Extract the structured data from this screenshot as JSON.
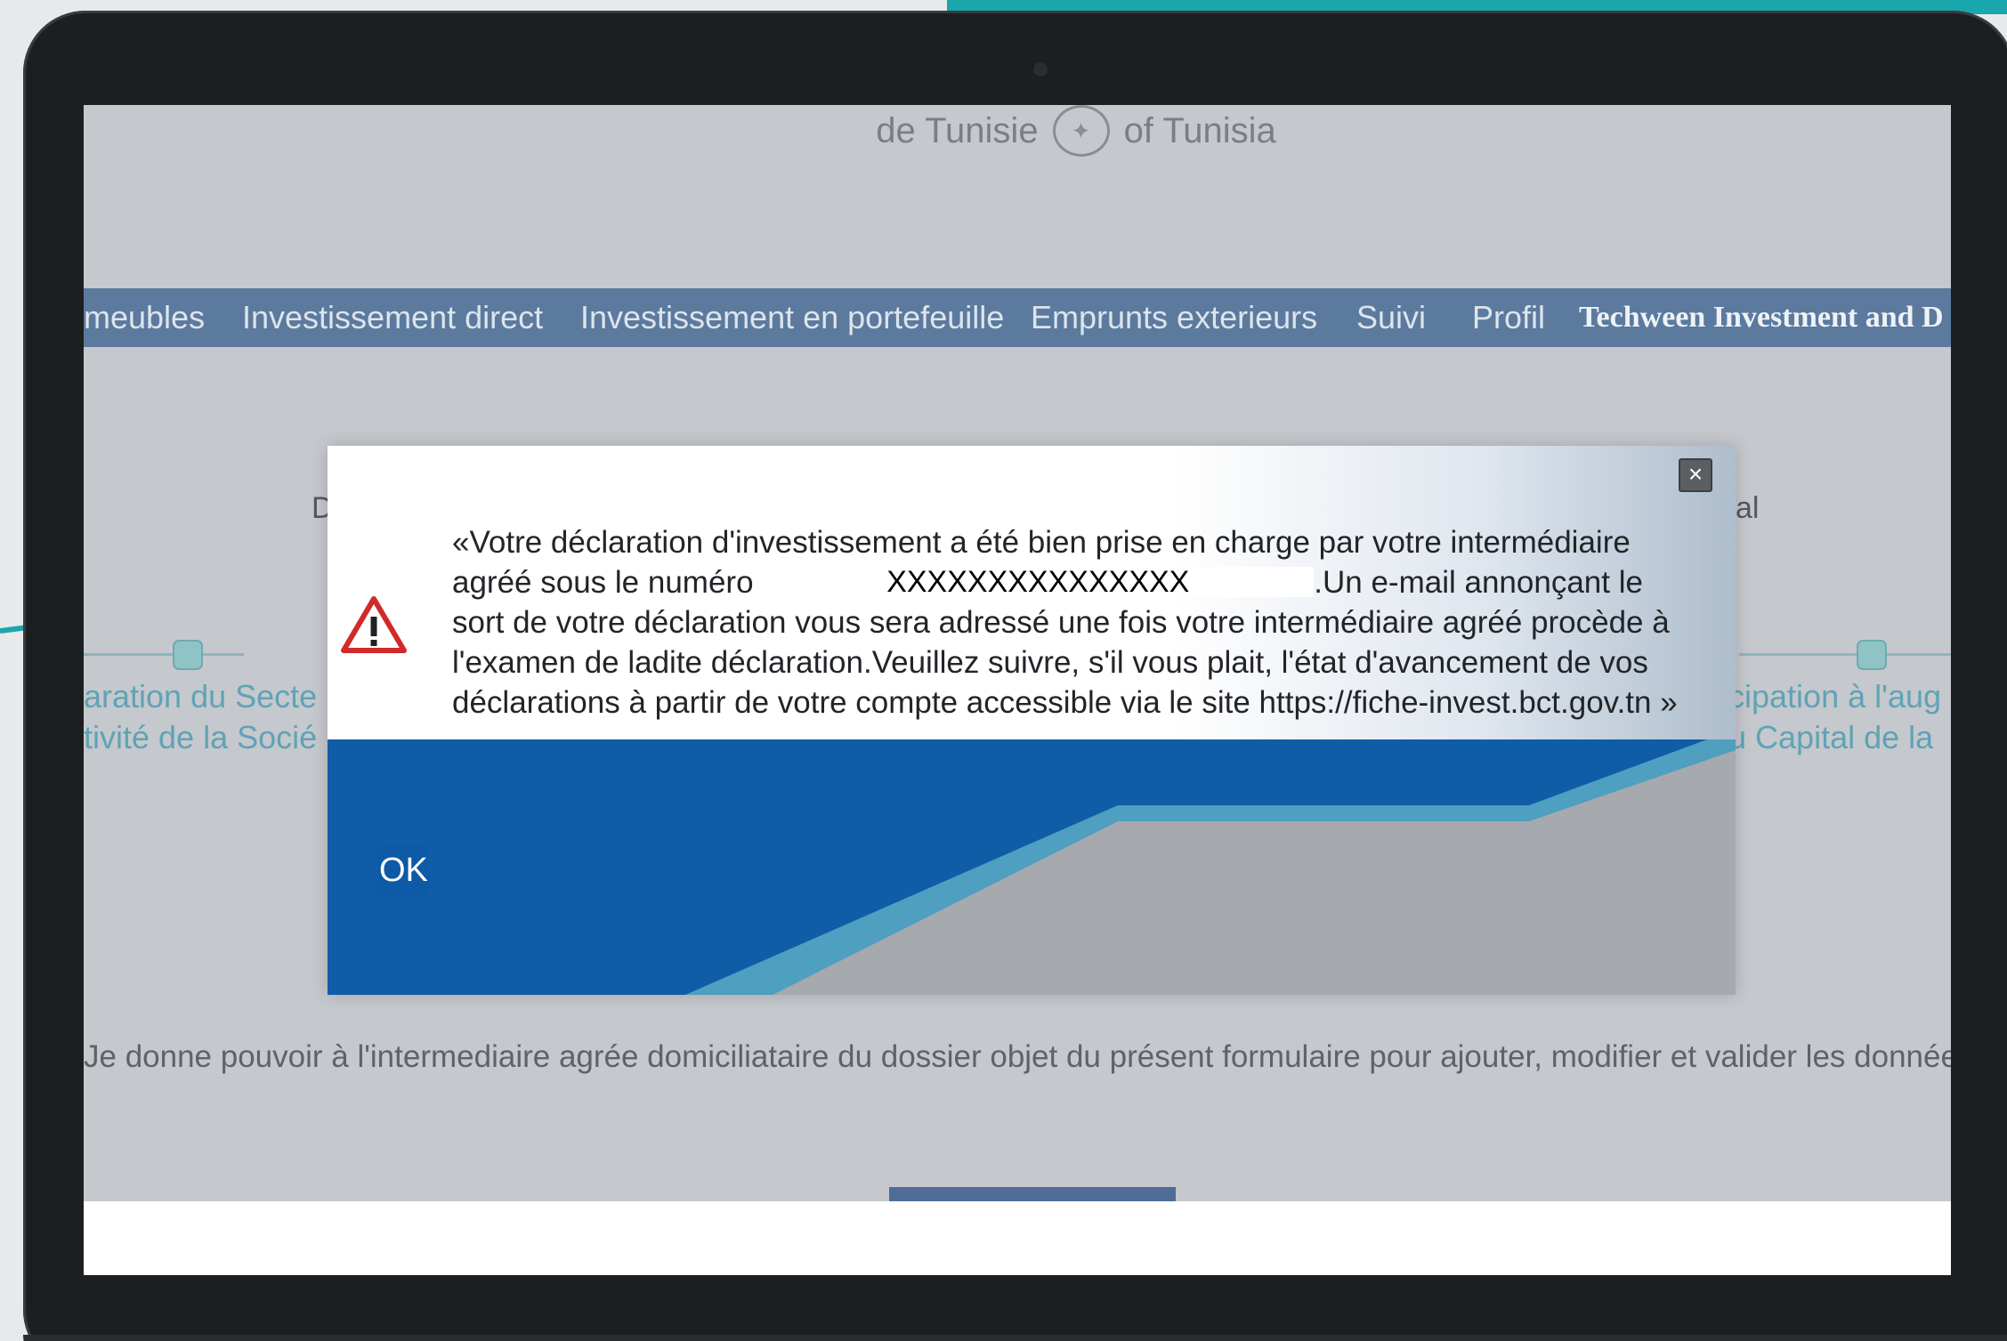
{
  "header": {
    "left_text": "de Tunisie",
    "right_text": "of Tunisia",
    "crest_icon": "crest-icon"
  },
  "nav": {
    "items": [
      "meubles",
      "Investissement direct",
      "Investissement en portefeuille",
      "Emprunts exterieurs",
      "Suivi",
      "Profil"
    ],
    "company": "Techween Investment and D"
  },
  "background_fragments": {
    "left_letter": "D",
    "right_letter": "al",
    "left_step_line1": "aration du Secte",
    "left_step_line2": "tivité de la Socié",
    "right_step_line1": "cipation à l'aug",
    "right_step_line2": "u Capital de la"
  },
  "consent_text": "Je donne pouvoir à l'intermediaire agrée domiciliataire du dossier objet du présent formulaire pour ajouter, modifier et valider les données d",
  "modal": {
    "message_part1": "«Votre déclaration d'investissement a été bien prise en charge par votre intermédiaire agréé sous le numéro",
    "reference_number": "XXXXXXXXXXXXXXX",
    "message_part2": ".Un e-mail annonçant le sort de votre déclaration vous sera adressé une fois votre intermédiaire agréé procède à l'examen de ladite déclaration.Veuillez suivre, s'il vous plait, l'état d'avancement de vos déclarations à partir de votre compte accessible via le site https://fiche-invest.bct.gov.tn »",
    "ok_label": "OK",
    "close_label": "×",
    "warning_icon": "warning-icon"
  },
  "colors": {
    "accent_teal": "#1aa6ad",
    "nav_blue": "#5b7a9e",
    "modal_dark_blue": "#0d5aa6",
    "modal_light_blue": "#4e9fc0"
  }
}
